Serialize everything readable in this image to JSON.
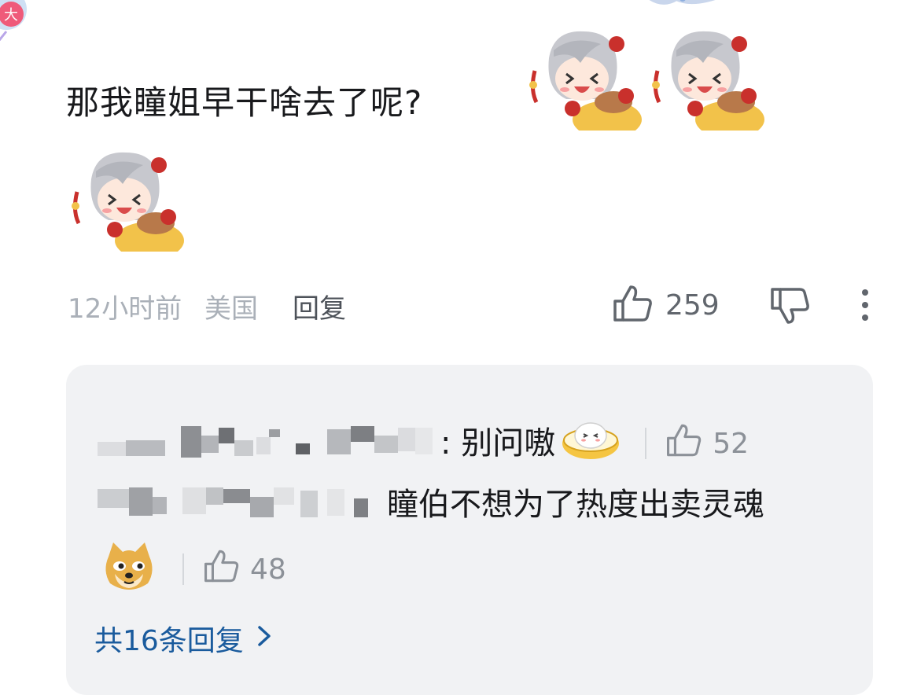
{
  "comment": {
    "text": "那我瞳姐早干啥去了呢?",
    "avatar_badge": "大",
    "time": "12小时前",
    "location": "美国",
    "reply_label": "回复",
    "like_count": "259"
  },
  "replies": [
    {
      "text": ": 别问嗷",
      "like_count": "52",
      "emoji": "bowl-emoji"
    },
    {
      "text": "瞳伯不想为了热度出卖灵魂",
      "like_count": "48",
      "emoji": "doge-emoji"
    }
  ],
  "view_more": {
    "label": "共16条回复"
  },
  "colors": {
    "link": "#1a5b9d",
    "meta": "#aab0b8",
    "reply_bg": "#f1f2f4"
  }
}
